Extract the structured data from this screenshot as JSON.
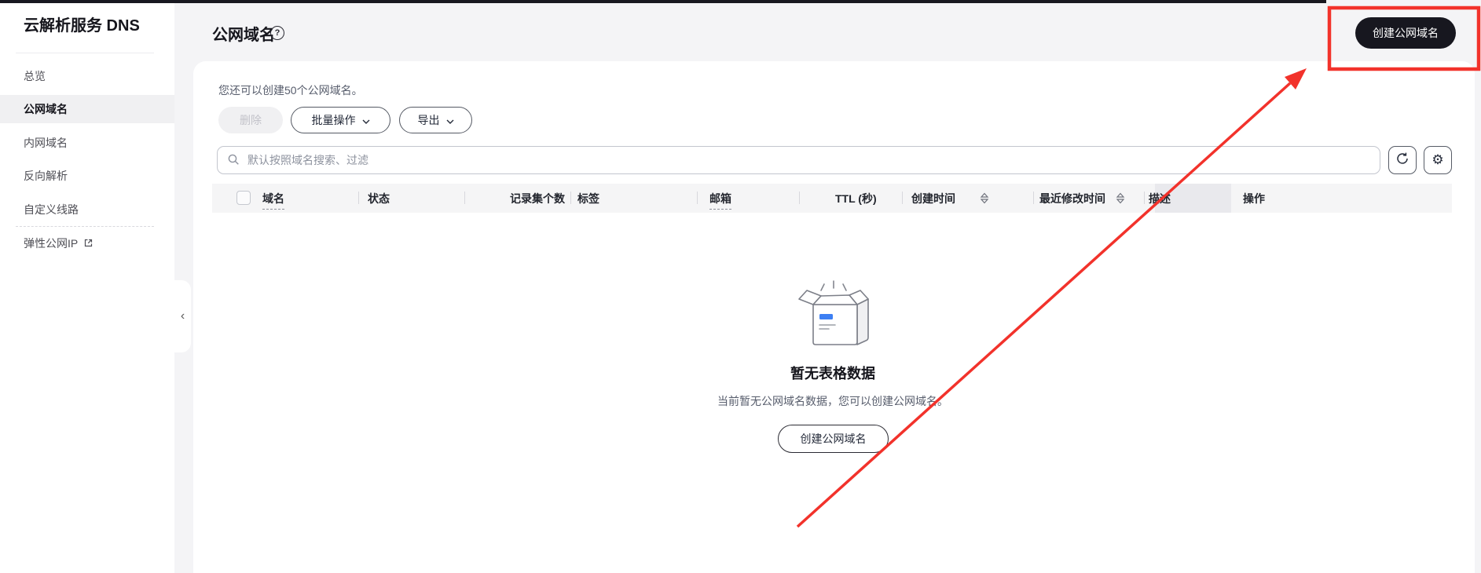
{
  "sidebar": {
    "title": "云解析服务 DNS",
    "collapse_icon": "‹",
    "items": [
      {
        "label": "总览",
        "selected": false
      },
      {
        "label": "公网域名",
        "selected": true
      },
      {
        "label": "内网域名",
        "selected": false
      },
      {
        "label": "反向解析",
        "selected": false
      },
      {
        "label": "自定义线路",
        "selected": false
      },
      {
        "label": "弹性公网IP",
        "selected": false,
        "external": true
      }
    ]
  },
  "header": {
    "title": "公网域名",
    "help_icon": "?",
    "create_button_label": "创建公网域名"
  },
  "toolbar": {
    "quota_text": "您还可以创建50个公网域名。",
    "delete_label": "删除",
    "batch_label": "批量操作",
    "export_label": "导出",
    "search_placeholder": "默认按照域名搜索、过滤",
    "gear_icon": "⚙"
  },
  "table": {
    "columns": [
      {
        "label": "域名",
        "filter_hint": "dashed-underline"
      },
      {
        "label": "状态"
      },
      {
        "label": "记录集个数"
      },
      {
        "label": "标签"
      },
      {
        "label": "邮箱",
        "filter_hint": "dashed-underline"
      },
      {
        "label": "TTL (秒)"
      },
      {
        "label": "创建时间",
        "sortable": true
      },
      {
        "label": "最近修改时间",
        "sortable": true
      },
      {
        "label": "描述"
      },
      {
        "label": "操作"
      }
    ]
  },
  "empty_state": {
    "title": "暂无表格数据",
    "description": "当前暂无公网域名数据，您可以创建公网域名。",
    "button_label": "创建公网域名"
  },
  "annotation": {
    "highlight_color": "#f2322b"
  },
  "colors": {
    "primary_button_bg": "#17171f",
    "accent_blue": "#3d7ff3",
    "table_header_bg": "#f5f5f6"
  }
}
